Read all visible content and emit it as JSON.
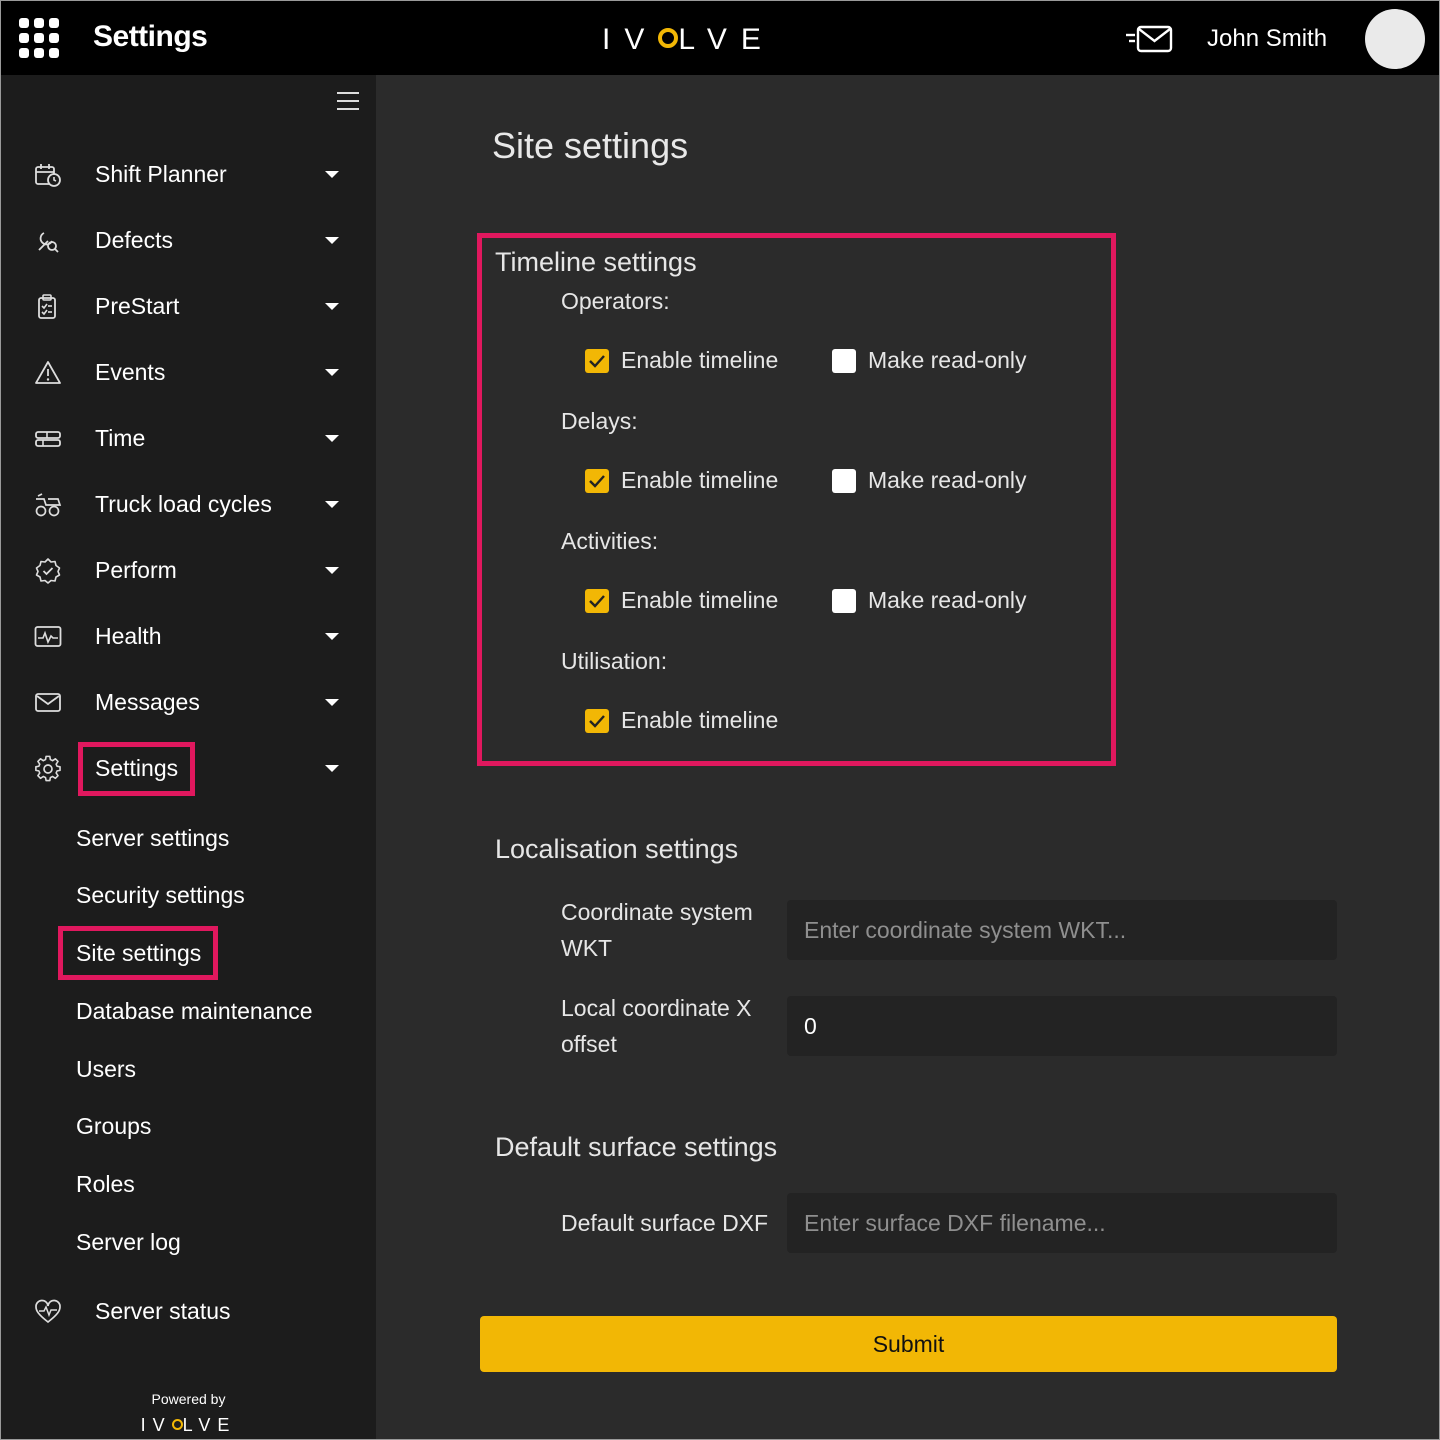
{
  "header": {
    "title": "Settings",
    "brand": {
      "pre": "IV",
      "post": "LVE"
    },
    "user_name": "John Smith"
  },
  "sidebar": {
    "items": [
      {
        "label": "Shift Planner",
        "icon": "calendar-clock-icon"
      },
      {
        "label": "Defects",
        "icon": "wrench-search-icon"
      },
      {
        "label": "PreStart",
        "icon": "clipboard-check-icon"
      },
      {
        "label": "Events",
        "icon": "warning-triangle-icon"
      },
      {
        "label": "Time",
        "icon": "server-rows-icon"
      },
      {
        "label": "Truck load cycles",
        "icon": "truck-cycle-icon"
      },
      {
        "label": "Perform",
        "icon": "badge-check-icon"
      },
      {
        "label": "Health",
        "icon": "pulse-monitor-icon"
      },
      {
        "label": "Messages",
        "icon": "envelope-icon"
      },
      {
        "label": "Settings",
        "icon": "gear-icon"
      }
    ],
    "settings_sub": [
      "Server settings",
      "Security settings",
      "Site settings",
      "Database maintenance",
      "Users",
      "Groups",
      "Roles",
      "Server log"
    ],
    "server_status": "Server status",
    "powered_by": "Powered by",
    "powered_brand": {
      "pre": "IV",
      "post": "LVE"
    }
  },
  "main": {
    "page_title": "Site settings",
    "timeline": {
      "title": "Timeline settings",
      "groups": [
        {
          "label": "Operators:",
          "enable_label": "Enable timeline",
          "enable": true,
          "readonly_label": "Make read-only",
          "readonly": false
        },
        {
          "label": "Delays:",
          "enable_label": "Enable timeline",
          "enable": true,
          "readonly_label": "Make read-only",
          "readonly": false
        },
        {
          "label": "Activities:",
          "enable_label": "Enable timeline",
          "enable": true,
          "readonly_label": "Make read-only",
          "readonly": false
        },
        {
          "label": "Utilisation:",
          "enable_label": "Enable timeline",
          "enable": true
        }
      ]
    },
    "localisation": {
      "title": "Localisation settings",
      "wkt_label_1": "Coordinate system",
      "wkt_label_2": "WKT",
      "wkt_placeholder": "Enter coordinate system WKT...",
      "wkt_value": "",
      "x_offset_label_1": "Local coordinate X",
      "x_offset_label_2": "offset",
      "x_offset_value": "0"
    },
    "surface": {
      "title": "Default surface settings",
      "dxf_label": "Default surface DXF",
      "dxf_placeholder": "Enter surface DXF filename...",
      "dxf_value": ""
    },
    "submit_label": "Submit"
  },
  "colors": {
    "accent": "#f2b705",
    "highlight": "#e0185e",
    "topbar": "#000000",
    "sidebar": "#1c1c1c",
    "background": "#2b2b2b"
  }
}
